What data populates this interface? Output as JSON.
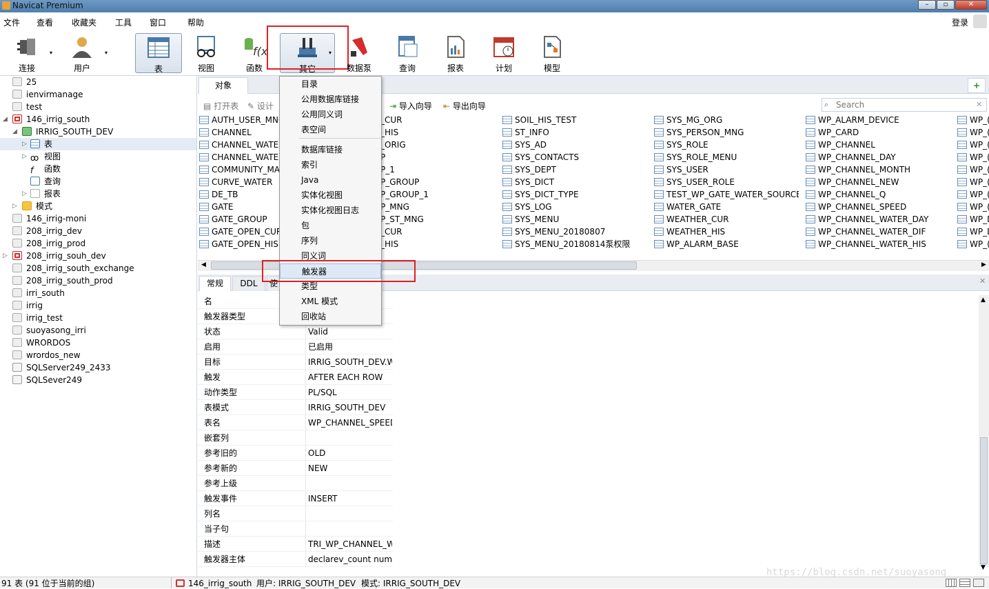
{
  "window": {
    "title": "Navicat Premium"
  },
  "menu": {
    "file": "文件",
    "view": "查看",
    "favorites": "收藏夹",
    "tools": "工具",
    "window": "窗口",
    "help": "帮助",
    "login": "登录"
  },
  "toolbar": {
    "connect": "连接",
    "user": "用户",
    "table": "表",
    "view": "视图",
    "function": "函数",
    "other": "其它",
    "datapump": "数据泵",
    "query": "查询",
    "report": "报表",
    "schedule": "计划",
    "model": "模型"
  },
  "tree": {
    "items": [
      "25",
      "ienvirmanage",
      "test",
      "146_irrig_south",
      "IRRIG_SOUTH_DEV",
      "表",
      "视图",
      "函数",
      "查询",
      "报表",
      "模式",
      "146_irrig-moni",
      "208_irrig_dev",
      "208_irrig_prod",
      "208_irrig_souh_dev",
      "208_irrig_south_exchange",
      "208_irrig_south_prod",
      "irri_south",
      "irrig",
      "irrig_test",
      "suoyasong_irri",
      "WRORDOS",
      "wrordos_new",
      "SQLServer249_2433",
      "SQLSever249"
    ]
  },
  "objects_tab": "对象",
  "actions": {
    "open_table": "打开表",
    "design": "设计",
    "import": "导入向导",
    "export": "导出向导"
  },
  "search": {
    "placeholder": "Search"
  },
  "grid": {
    "col1": [
      "AUTH_USER_MNG",
      "CHANNEL",
      "CHANNEL_WATE",
      "CHANNEL_WATE",
      "COMMUNITY_MA",
      "CURVE_WATER",
      "DE_TB",
      "GATE",
      "GATE_GROUP",
      "GATE_OPEN_CUR",
      "GATE_OPEN_HIS"
    ],
    "col2": [
      "_CUR",
      "_HIS",
      "_ORIG",
      "P",
      "P_1",
      "P_GROUP",
      "P_GROUP_1",
      "P_MNG",
      "P_ST_MNG",
      "_CUR",
      "_HIS"
    ],
    "col3": [
      "SOIL_HIS_TEST",
      "ST_INFO",
      "SYS_AD",
      "SYS_CONTACTS",
      "SYS_DEPT",
      "SYS_DICT",
      "SYS_DICT_TYPE",
      "SYS_LOG",
      "SYS_MENU",
      "SYS_MENU_20180807",
      "SYS_MENU_20180814泵权限"
    ],
    "col4": [
      "SYS_MG_ORG",
      "SYS_PERSON_MNG",
      "SYS_ROLE",
      "SYS_ROLE_MENU",
      "SYS_USER",
      "SYS_USER_ROLE",
      "TEST_WP_GATE_WATER_SOURCE",
      "WATER_GATE",
      "WEATHER_CUR",
      "WEATHER_HIS",
      "WP_ALARM_BASE"
    ],
    "col5": [
      "WP_ALARM_DEVICE",
      "WP_CARD",
      "WP_CHANNEL",
      "WP_CHANNEL_DAY",
      "WP_CHANNEL_MONTH",
      "WP_CHANNEL_NEW",
      "WP_CHANNEL_Q",
      "WP_CHANNEL_SPEED",
      "WP_CHANNEL_WATER_DAY",
      "WP_CHANNEL_WATER_DIF",
      "WP_CHANNEL_WATER_HIS"
    ],
    "col6": [
      "WP_(",
      "WP_(",
      "WP_(",
      "WP_(",
      "WP_(",
      "WP_(",
      "WP_(",
      "WP_(",
      "WP_D",
      "WP_D",
      "WP_("
    ]
  },
  "bottom_tabs": {
    "general": "常规",
    "ddl": "DDL",
    "usage": "使"
  },
  "properties": [
    {
      "k": "名",
      "v": ""
    },
    {
      "k": "触发器类型",
      "v": ""
    },
    {
      "k": "状态",
      "v": "Valid"
    },
    {
      "k": "启用",
      "v": "已启用"
    },
    {
      "k": "目标",
      "v": "IRRIG_SOUTH_DEV.W"
    },
    {
      "k": "触发",
      "v": "AFTER EACH ROW"
    },
    {
      "k": "动作类型",
      "v": "PL/SQL"
    },
    {
      "k": "表模式",
      "v": "IRRIG_SOUTH_DEV"
    },
    {
      "k": "表名",
      "v": "WP_CHANNEL_SPEED"
    },
    {
      "k": "嵌套列",
      "v": ""
    },
    {
      "k": "参考旧的",
      "v": "OLD"
    },
    {
      "k": "参考新的",
      "v": "NEW"
    },
    {
      "k": "参考上级",
      "v": ""
    },
    {
      "k": "触发事件",
      "v": "INSERT"
    },
    {
      "k": "列名",
      "v": ""
    },
    {
      "k": "当子句",
      "v": ""
    },
    {
      "k": "描述",
      "v": "TRI_WP_CHANNEL_W"
    },
    {
      "k": "触发器主体",
      "v": "declarev_count numb"
    }
  ],
  "dropdown": {
    "items": [
      "目录",
      "公用数据库链接",
      "公用同义词",
      "表空间",
      "数据库链接",
      "索引",
      "Java",
      "实体化视图",
      "实体化视图日志",
      "包",
      "序列",
      "同义词",
      "触发器",
      "类型",
      "XML 模式",
      "回收站"
    ],
    "highlighted": "触发器"
  },
  "status": {
    "count": "91 表 (91 位于当前的组)",
    "connection": "146_irrig_south",
    "user": "用户: IRRIG_SOUTH_DEV",
    "schema": "模式: IRRIG_SOUTH_DEV"
  },
  "watermark": "https://blog.csdn.net/suoyasong"
}
